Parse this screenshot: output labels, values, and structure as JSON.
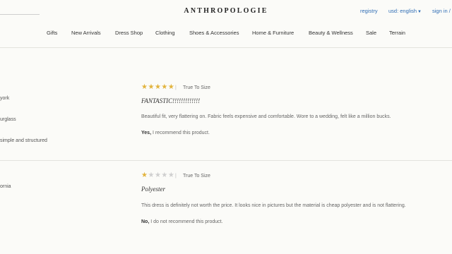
{
  "header": {
    "logo": "ANTHROPOLOGIE",
    "registry": "registry",
    "locale": "usd: english",
    "signin": "sign in / "
  },
  "nav": {
    "items": [
      "Gifts",
      "New Arrivals",
      "Dress Shop",
      "Clothing",
      "Shoes & Accessories",
      "Home & Furniture",
      "Beauty & Wellness",
      "Sale",
      "Terrain"
    ]
  },
  "reviews": [
    {
      "reviewer_details": [
        "york",
        "urglass",
        "simple and structured"
      ],
      "rating": 5,
      "fit": "True To Size",
      "title": "FANTASTIC!!!!!!!!!!!!!",
      "body": "Beautiful fit, very flattering on. Fabric feels expensive and comfortable. Wore to a wedding, felt like a million bucks.",
      "rec_bold": "Yes,",
      "rec_text": " I recommend this product."
    },
    {
      "reviewer_details": [
        "ornia"
      ],
      "rating": 1,
      "fit": "True To Size",
      "title": "Polyester",
      "body": "This dress is definitely not worth the price. It looks nice in pictures but the material is cheap polyester and is not flattering.",
      "rec_bold": "No,",
      "rec_text": " I do not recommend this product."
    }
  ],
  "colors": {
    "star_on": "#e2b33c",
    "star_off": "#cfcfcf",
    "link": "#2f6db5"
  }
}
